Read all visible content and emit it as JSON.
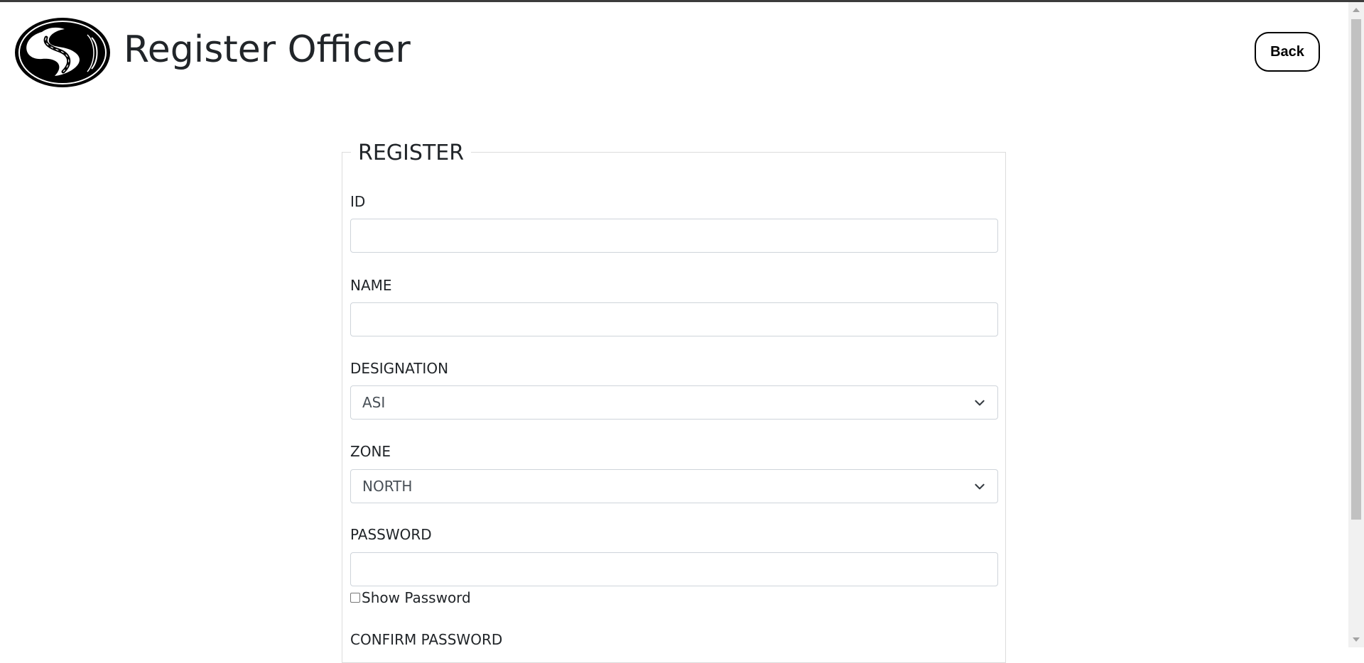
{
  "header": {
    "title": "Register Officer",
    "back_label": "Back",
    "logo_icon": "road-logo-icon"
  },
  "form": {
    "legend": "REGISTER",
    "fields": {
      "id": {
        "label": "ID",
        "value": ""
      },
      "name": {
        "label": "NAME",
        "value": ""
      },
      "designation": {
        "label": "DESIGNATION",
        "selected": "ASI"
      },
      "zone": {
        "label": "ZONE",
        "selected": "NORTH"
      },
      "password": {
        "label": "PASSWORD",
        "value": ""
      },
      "show_password": {
        "label": "Show Password",
        "checked": false
      },
      "confirm_password": {
        "label": "CONFIRM PASSWORD"
      }
    }
  },
  "colors": {
    "text": "#212529",
    "input_border": "#ced4da",
    "fieldset_border": "#dcdcdc",
    "scroll_thumb": "#c1c1c1"
  }
}
